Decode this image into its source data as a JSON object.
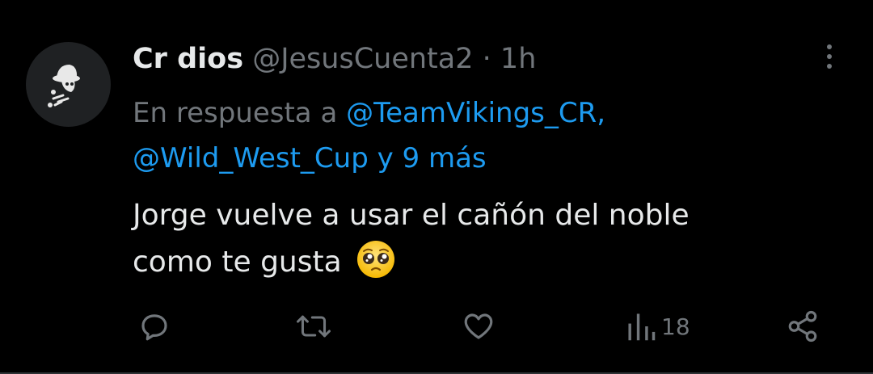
{
  "tweet": {
    "display_name": "Cr dios",
    "handle": "@JesusCuenta2",
    "separator": "·",
    "time": "1h",
    "reply_prefix": "En respuesta a",
    "reply_mention_1": "@TeamVikings_CR,",
    "reply_mention_2": "@Wild_West_Cup y 9 más",
    "text_line_1": "Jorge vuelve a usar el cañón del noble",
    "text_line_2": "como te gusta",
    "emoji": "pleading-face"
  },
  "actions": {
    "reply_icon": "speech-bubble-icon",
    "retweet_icon": "retweet-icon",
    "like_icon": "heart-icon",
    "views_icon": "bar-chart-icon",
    "views_count": "18",
    "share_icon": "share-icon"
  },
  "colors": {
    "background": "#000000",
    "text": "#e7e9ea",
    "muted": "#71767b",
    "link": "#1d9bf0"
  }
}
